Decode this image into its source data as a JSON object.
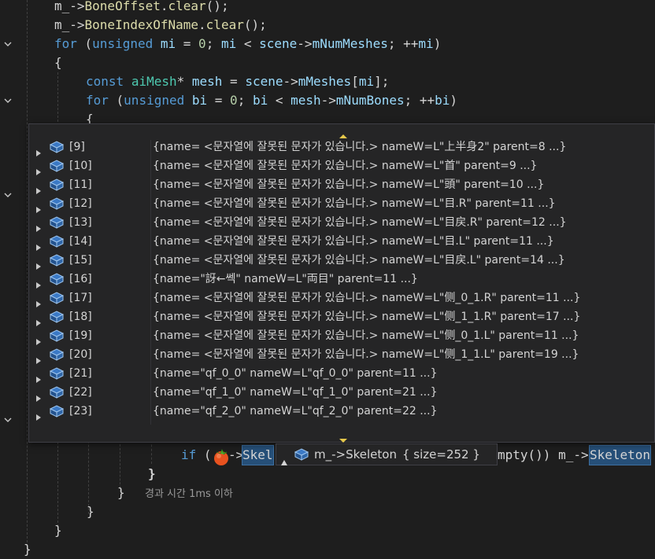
{
  "editor": {
    "lines": [
      {
        "tokens": [
          [
            "plain",
            "m_->"
          ],
          [
            "fn",
            "BoneOffset"
          ],
          [
            "plain",
            "."
          ],
          [
            "fn",
            "clear"
          ],
          [
            "plain",
            "();"
          ]
        ]
      },
      {
        "tokens": [
          [
            "plain",
            "m_->"
          ],
          [
            "fn",
            "BoneIndexOfName"
          ],
          [
            "plain",
            "."
          ],
          [
            "fn",
            "clear"
          ],
          [
            "plain",
            "();"
          ]
        ]
      },
      {
        "tokens": [
          [
            "kw",
            "for"
          ],
          [
            "plain",
            " ("
          ],
          [
            "kw",
            "unsigned"
          ],
          [
            "plain",
            " "
          ],
          [
            "var",
            "mi"
          ],
          [
            "plain",
            " = "
          ],
          [
            "num",
            "0"
          ],
          [
            "plain",
            "; "
          ],
          [
            "var",
            "mi"
          ],
          [
            "plain",
            " < "
          ],
          [
            "var",
            "scene"
          ],
          [
            "plain",
            "->"
          ],
          [
            "var",
            "mNumMeshes"
          ],
          [
            "plain",
            "; ++"
          ],
          [
            "var",
            "mi"
          ],
          [
            "plain",
            ")"
          ]
        ]
      },
      {
        "tokens": [
          [
            "plain",
            "{"
          ]
        ]
      },
      {
        "tokens": [
          [
            "kw",
            "const"
          ],
          [
            "plain",
            " "
          ],
          [
            "type",
            "aiMesh"
          ],
          [
            "plain",
            "* "
          ],
          [
            "var",
            "mesh"
          ],
          [
            "plain",
            " = "
          ],
          [
            "var",
            "scene"
          ],
          [
            "plain",
            "->"
          ],
          [
            "var",
            "mMeshes"
          ],
          [
            "plain",
            "["
          ],
          [
            "var",
            "mi"
          ],
          [
            "plain",
            "];"
          ]
        ]
      },
      {
        "tokens": [
          [
            "kw",
            "for"
          ],
          [
            "plain",
            " ("
          ],
          [
            "kw",
            "unsigned"
          ],
          [
            "plain",
            " "
          ],
          [
            "var",
            "bi"
          ],
          [
            "plain",
            " = "
          ],
          [
            "num",
            "0"
          ],
          [
            "plain",
            "; "
          ],
          [
            "var",
            "bi"
          ],
          [
            "plain",
            " < "
          ],
          [
            "var",
            "mesh"
          ],
          [
            "plain",
            "->"
          ],
          [
            "var",
            "mNumBones"
          ],
          [
            "plain",
            "; ++"
          ],
          [
            "var",
            "bi"
          ],
          [
            "plain",
            ")"
          ]
        ]
      },
      {
        "tokens": [
          [
            "plain",
            "{"
          ]
        ]
      }
    ],
    "if_line": {
      "if_kw": "if",
      "open_paren": "(",
      "partial": "->",
      "skel_a": "Skel",
      "after_tip": "mpty()) m_->",
      "skel_b": "Skeleton"
    },
    "closing": {
      "brace1": "}",
      "brace2": "}",
      "brace3": "}",
      "brace4": "}",
      "brace5": "}"
    },
    "elapsed_text": "경과 시간 1ms 이하"
  },
  "datatip": {
    "rows": [
      {
        "index": "[9]",
        "value": "{name= <문자열에 잘못된 문자가 있습니다.> nameW=L\"上半身2\" parent=8 ...}"
      },
      {
        "index": "[10]",
        "value": "{name= <문자열에 잘못된 문자가 있습니다.> nameW=L\"首\" parent=9 ...}"
      },
      {
        "index": "[11]",
        "value": "{name= <문자열에 잘못된 문자가 있습니다.> nameW=L\"頭\" parent=10 ...}"
      },
      {
        "index": "[12]",
        "value": "{name= <문자열에 잘못된 문자가 있습니다.> nameW=L\"目.R\" parent=11 ...}"
      },
      {
        "index": "[13]",
        "value": "{name= <문자열에 잘못된 문자가 있습니다.> nameW=L\"目戻.R\" parent=12 ...}"
      },
      {
        "index": "[14]",
        "value": "{name= <문자열에 잘못된 문자가 있습니다.> nameW=L\"目.L\" parent=11 ...}"
      },
      {
        "index": "[15]",
        "value": "{name= <문자열에 잘못된 문자가 있습니다.> nameW=L\"目戻.L\" parent=14 ...}"
      },
      {
        "index": "[16]",
        "value": "{name=\"訝←쎅\" nameW=L\"両目\" parent=11 ...}"
      },
      {
        "index": "[17]",
        "value": "{name= <문자열에 잘못된 문자가 있습니다.> nameW=L\"侧_0_1.R\" parent=11 ...}"
      },
      {
        "index": "[18]",
        "value": "{name= <문자열에 잘못된 문자가 있습니다.> nameW=L\"侧_1_1.R\" parent=17 ...}"
      },
      {
        "index": "[19]",
        "value": "{name= <문자열에 잘못된 문자가 있습니다.> nameW=L\"侧_0_1.L\" parent=11 ...}"
      },
      {
        "index": "[20]",
        "value": "{name= <문자열에 잘못된 문자가 있습니다.> nameW=L\"侧_1_1.L\" parent=19 ...}"
      },
      {
        "index": "[21]",
        "value": "{name=\"qf_0_0\" nameW=L\"qf_0_0\" parent=11 ...}"
      },
      {
        "index": "[22]",
        "value": "{name=\"qf_1_0\" nameW=L\"qf_1_0\" parent=21 ...}"
      },
      {
        "index": "[23]",
        "value": "{name=\"qf_2_0\" nameW=L\"qf_2_0\" parent=22 ...}"
      }
    ]
  },
  "child_tip": {
    "expression": "m_->Skeleton",
    "size_text": "{ size=252 }"
  },
  "colors": {
    "editor_bg": "#1e1e1e",
    "tip_bg": "#252526",
    "keyword": "#569cd6",
    "variable": "#9cdcfe",
    "function": "#dcdcaa",
    "type": "#4ec9b0",
    "number": "#b5cea8",
    "highlight": "#264f78"
  },
  "icons": [
    "chevron-down-icon",
    "triangle-right-icon",
    "object-cube-icon",
    "scroll-up-icon",
    "scroll-down-icon",
    "triangle-up-icon",
    "tomato-icon"
  ]
}
